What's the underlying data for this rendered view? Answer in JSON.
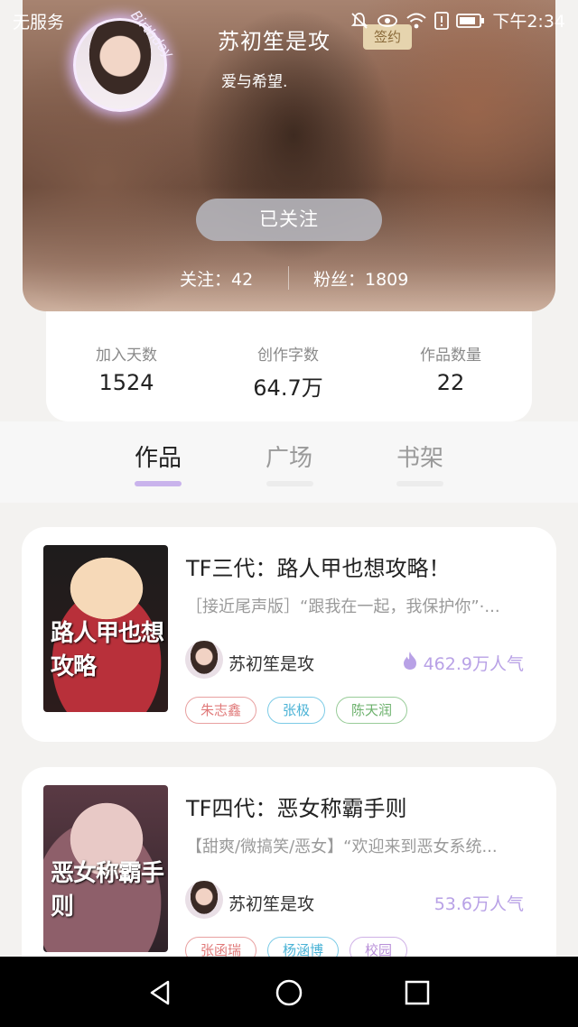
{
  "status_bar": {
    "carrier": "无服务",
    "time": "下午2:34"
  },
  "profile": {
    "name": "苏初笙是攻",
    "badge": "签约",
    "bio": "爱与希望.",
    "avatar_frame_text": "Birthday",
    "follow_button": "已关注",
    "following_label": "关注：42",
    "fans_label": "粉丝：1809"
  },
  "info": [
    {
      "label": "加入天数",
      "value": "1524"
    },
    {
      "label": "创作字数",
      "value": "64.7万"
    },
    {
      "label": "作品数量",
      "value": "22"
    }
  ],
  "tabs": [
    {
      "label": "作品",
      "active": true
    },
    {
      "label": "广场",
      "active": false
    },
    {
      "label": "书架",
      "active": false
    }
  ],
  "books": [
    {
      "title": "TF三代：路人甲也想攻略！",
      "desc": "［接近尾声版］“跟我在一起，我保护你”·...",
      "cover_text": "路人甲也想攻略",
      "author": "苏初笙是攻",
      "popularity": "462.9万人气",
      "tags": [
        "朱志鑫",
        "张极",
        "陈天润"
      ]
    },
    {
      "title": "TF四代：恶女称霸手则",
      "desc": "【甜爽/微搞笑/恶女】“欢迎来到恶女系统...",
      "cover_text": "恶女称霸手则",
      "author": "苏初笙是攻",
      "popularity": "53.6万人气",
      "tags": [
        "张函瑞",
        "杨涵博",
        "校园"
      ]
    }
  ],
  "colors": {
    "accent": "#c9b3ec",
    "popularity": "#b8a1e6"
  },
  "icons": [
    "mute-icon",
    "eye-icon",
    "wifi-icon",
    "alert-icon",
    "battery-icon",
    "flame-icon",
    "back-icon",
    "home-icon",
    "recent-apps-icon"
  ]
}
